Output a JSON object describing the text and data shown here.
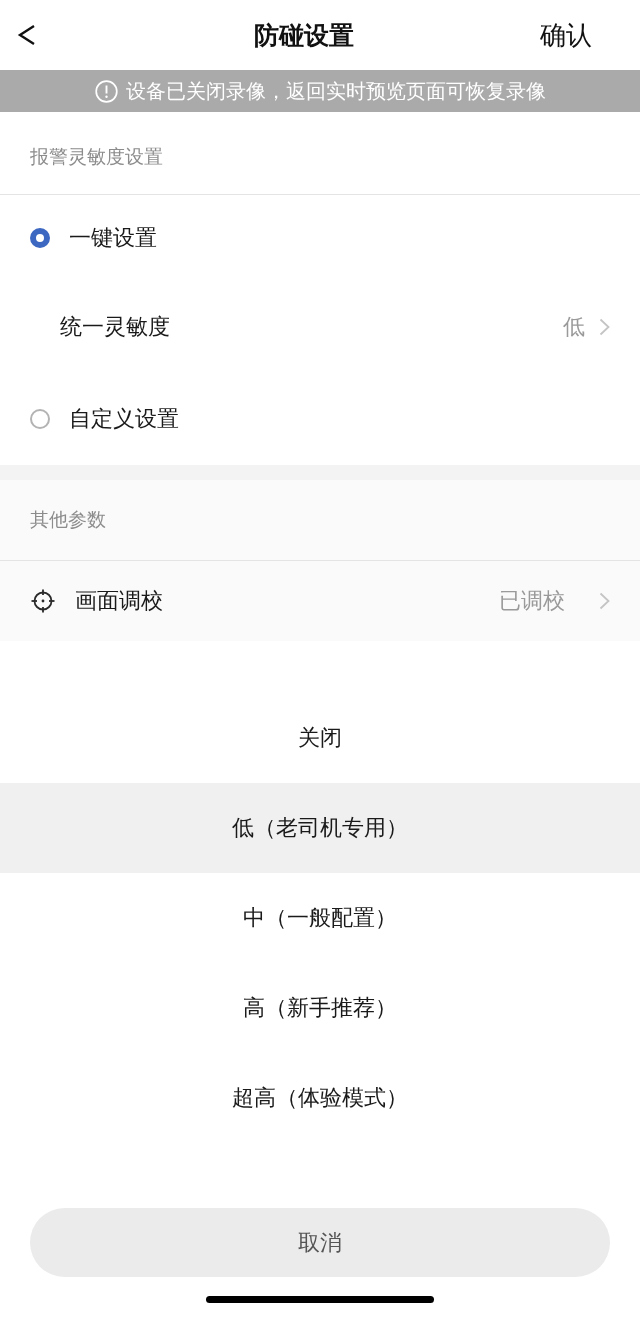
{
  "nav": {
    "title": "防碰设置",
    "confirm": "确认"
  },
  "notice": {
    "text": "设备已关闭录像，返回实时预览页面可恢复录像"
  },
  "sensitivity": {
    "title": "报警灵敏度设置",
    "rows": [
      {
        "kind": "radio",
        "label": "一键设置",
        "selected": true
      },
      {
        "kind": "sublink",
        "label": "统一灵敏度",
        "value": "低"
      },
      {
        "kind": "radio",
        "label": "自定义设置",
        "selected": false
      }
    ]
  },
  "other": {
    "title": "其他参数",
    "rows": [
      {
        "kind": "link",
        "label": "画面调校",
        "value": "已调校"
      }
    ]
  },
  "sheet": {
    "options": [
      {
        "label": "关闭",
        "selected": false
      },
      {
        "label": "低（老司机专用）",
        "selected": true
      },
      {
        "label": "中（一般配置）",
        "selected": false
      },
      {
        "label": "高（新手推荐）",
        "selected": false
      },
      {
        "label": "超高（体验模式）",
        "selected": false
      }
    ],
    "cancel": "取消"
  }
}
